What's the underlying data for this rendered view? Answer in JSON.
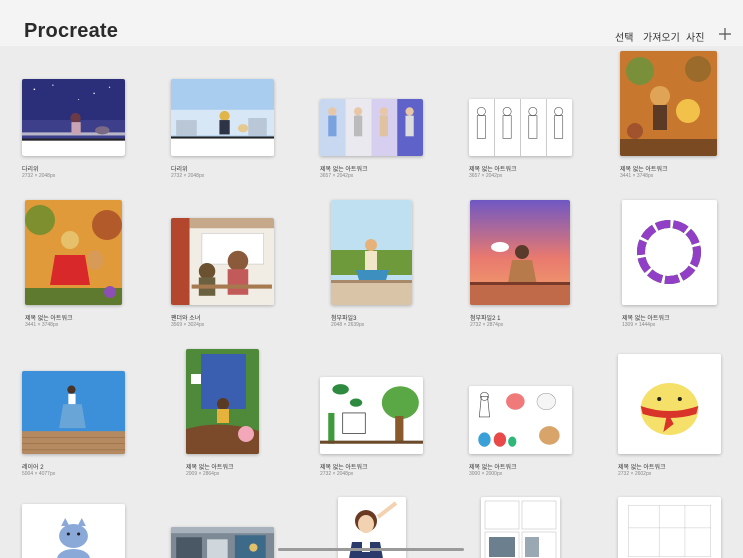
{
  "app": {
    "title": "Procreate"
  },
  "toolbar": {
    "select": "선택",
    "import": "가져오기",
    "photo": "사진",
    "add_icon": "plus-icon"
  },
  "gallery": {
    "items": [
      {
        "name": "다리위",
        "dims": "2732 × 2048px"
      },
      {
        "name": "다리위",
        "dims": "2732 × 2048px"
      },
      {
        "name": "제목 없는 아트워크",
        "dims": "3657 × 2042px"
      },
      {
        "name": "제목 없는 아트워크",
        "dims": "3657 × 2042px"
      },
      {
        "name": "제목 없는 아트워크",
        "dims": "3441 × 3748px"
      },
      {
        "name": "제목 없는 아트워크",
        "dims": "3441 × 3748px"
      },
      {
        "name": "팬더와 소녀",
        "dims": "3569 × 3024px"
      },
      {
        "name": "첨부파일3",
        "dims": "2048 × 2639px"
      },
      {
        "name": "첨부파일2 1",
        "dims": "2732 × 2874px"
      },
      {
        "name": "제목 없는 아트워크",
        "dims": "1309 × 1444px"
      },
      {
        "name": "레이어 2",
        "dims": "5004 × 4077px"
      },
      {
        "name": "제목 없는 아트워크",
        "dims": "2009 × 2864px"
      },
      {
        "name": "제목 없는 아트워크",
        "dims": "2732 × 2048px"
      },
      {
        "name": "제목 없는 아트워크",
        "dims": "3000 × 2000px"
      },
      {
        "name": "제목 없는 아트워크",
        "dims": "2732 × 2602px"
      }
    ]
  }
}
